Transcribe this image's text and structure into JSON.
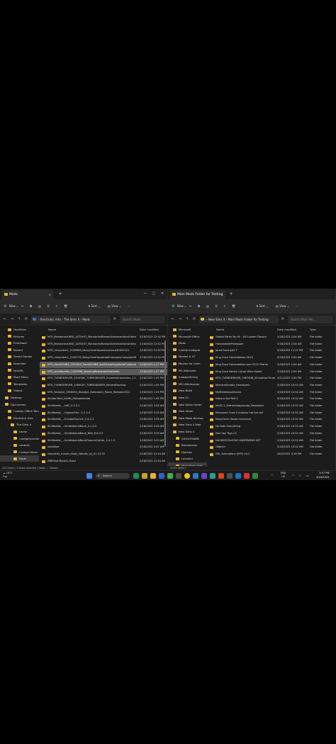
{
  "left": {
    "tab_title": "Mods",
    "toolbar": {
      "new": "New",
      "sort": "Sort",
      "view": "View"
    },
    "breadcrumb": "›  Electronic Arts  ›  The Sims 4  ›  Mods",
    "search_placeholder": "Search Mods",
    "columns": {
      "name": "Name",
      "date": "Date modified"
    },
    "nav": [
      {
        "label": "OneDrive"
      },
      {
        "label": "Pictures"
      },
      {
        "label": "PrintHood"
      },
      {
        "label": "Recent"
      },
      {
        "label": "Saved Games"
      },
      {
        "label": "Searches"
      },
      {
        "label": "SendTo"
      },
      {
        "label": "Start Menu"
      },
      {
        "label": "Templates"
      },
      {
        "label": "Videos"
      },
      {
        "label": "Desktop"
      },
      {
        "label": "Documents"
      },
      {
        "label": "Custom Office Tem"
      },
      {
        "label": "Electronic Arts"
      },
      {
        "label": "The Sims 4"
      },
      {
        "label": "cache"
      },
      {
        "label": "ConfigOverride"
      },
      {
        "label": "content"
      },
      {
        "label": "Custom Music"
      },
      {
        "label": "Mods"
      }
    ],
    "rows": [
      {
        "name": "MTS_Mandarinx0630_1875457_MandarinxRomanticInteractionsIntimateRelationships",
        "date": "2/18/2023 12:52 PM"
      },
      {
        "name": "MTS_Mandarinx0630_1875457_MandarinxRomanticInteractionsIntimateRelationships",
        "date": "2/18/2023 12:52 PM"
      },
      {
        "name": "MTS_nickyclem1_2198906_NickyClemHouseInsurance30092021",
        "date": "2/18/2023 12:52 PM"
      },
      {
        "name": "MTS_nickyclem1_2198776_NickyClemHouseholdCompanyComputerMenu",
        "date": "2/18/2023 12:52 PM"
      },
      {
        "name": "MTS_Sachi01884_2321815_Sachi01884_SachiLoveAnywhereCustomizationModHunt",
        "date": "2/18/2023 1:27 PM"
      },
      {
        "name": "MTS_scumbumbo_1553998_WorkingResidentialCabinets",
        "date": "2/18/2023 1:27 PM"
      },
      {
        "name": "MTS_TURBODRIVER_2529065_TURBODRIVER_Snowfreshlocksims_1.2",
        "date": "2/18/2023 1:05 PM"
      },
      {
        "name": "MTS_TURBODRIVER_2364097_TURBODRIVER_WhimsBlocking",
        "date": "2/18/2023 1:05 PM"
      },
      {
        "name": "MTS_Wuddyd_1966594_Wuddyd_Halloween_Movie_Remake2022",
        "date": "2/18/2023 1:05 PM"
      },
      {
        "name": "SimdanTalia_ACNH_Halloweensial",
        "date": "2/18/2023 1:05 PM"
      },
      {
        "name": "SimRealist_...UKC_0.2.3.1",
        "date": "2/18/2023 3:29 AM"
      },
      {
        "name": "SimRealist_...OrganicHer...2.1.3.4",
        "date": "2/18/2023 3:29 AM"
      },
      {
        "name": "SimRealist_...PrivatePractice_2.4.3.1",
        "date": "2/18/2023 3:29 AM"
      },
      {
        "name": "SimRealist_...SimNationalBank_3.1.0.5",
        "date": "2/18/2023 3:29 AM"
      },
      {
        "name": "SimRealist_...SimNationalBank_Bills_6.6.0.3",
        "date": "2/18/2023 3:29 AM"
      },
      {
        "name": "SimRealist_...SimNationalBankFinanceCenter_2.4.1.3",
        "date": "2/18/2023 3:29 AM"
      },
      {
        "name": "smobline",
        "date": "2/18/2023 3:47 AM"
      },
      {
        "name": "simplicity_tumalo_Body_Details_(z)_01.10.22",
        "date": "2/18/2023 12:44 AM"
      },
      {
        "name": "ZBEtristi.Blush5_Fixed",
        "date": "2/18/2023 12:53 AM"
      }
    ],
    "status": "414 items   |   2 items selected   |   State: ✓ Shared"
  },
  "right": {
    "tab_title": "Main Mods Folder for Testing",
    "toolbar": {
      "new": "New",
      "sort": "Sort",
      "view": "View"
    },
    "breadcrumb": "›  New Sims 4  ›  Main Mods Folder for Testing",
    "search_placeholder": "Search Main Mo...",
    "columns": {
      "name": "Name",
      "date": "Date modified",
      "type": "Type"
    },
    "nav": [
      {
        "label": "Microsoft"
      },
      {
        "label": "Microsoft Office"
      },
      {
        "label": "Mods"
      },
      {
        "label": "mothermodspm"
      },
      {
        "label": "Movies & XT"
      },
      {
        "label": "Movies for Calm"
      },
      {
        "label": "MS Alternate"
      },
      {
        "label": "msbaseid.tmp"
      },
      {
        "label": "MSI Afterburner"
      },
      {
        "label": "New Build"
      },
      {
        "label": "New CC"
      },
      {
        "label": "New Disco Folder"
      },
      {
        "label": "New folder"
      },
      {
        "label": "New Mods Backup"
      },
      {
        "label": "New Sims 4 Mod"
      },
      {
        "label": "New Sims 4"
      },
      {
        "label": "ZHOOTHAME"
      },
      {
        "label": "Bravescolor"
      },
      {
        "label": "Diamdo"
      },
      {
        "label": "Lancolor"
      },
      {
        "label": "Main Mods Fold"
      }
    ],
    "rows": [
      {
        "name": "Gelato Parlor By LB - 16 Custom Flavors",
        "date": "5/18/2023 2:04 AM",
        "type": "File folder"
      },
      {
        "name": "HarvestablePineapple",
        "date": "5/18/2023 2:04 AM",
        "type": "File folder"
      },
      {
        "name": "Jared Food part 7",
        "date": "5/18/2023 11:27 PM",
        "type": "File folder"
      },
      {
        "name": "King Zace Harvestables 2023",
        "date": "5/18/2023 2:04 AM",
        "type": "File folder"
      },
      {
        "name": "King Zace Harvestables and SCCO Plants",
        "date": "5/18/2023 2:04 AM",
        "type": "File folder"
      },
      {
        "name": "King Zace Nectar Liquor Wine Maker",
        "date": "5/18/2023 2:04 AM",
        "type": "File folder"
      },
      {
        "name": "MTS_TURBODRIVER_1967638_SimulationTimeIm...",
        "date": "4/11/2023 2:45 PM",
        "type": "File folder"
      },
      {
        "name": "MythicalAnodie_Headsome",
        "date": "5/18/2023 10:52 AM",
        "type": "File folder"
      },
      {
        "name": "MyMetalshopStories",
        "date": "5/18/2023 10:52 AM",
        "type": "File folder"
      },
      {
        "name": "Nahara Set Part 2",
        "date": "5/18/2023 10:52 AM",
        "type": "File folder"
      },
      {
        "name": "NCAT_2_ExtremeApprovals_Reworked",
        "date": "5/18/2023 10:52 AM",
        "type": "File folder"
      },
      {
        "name": "Nicksome Crew 4 outdoor hot tub set",
        "date": "5/18/2023 10:52 AM",
        "type": "File folder"
      },
      {
        "name": "NickyClem House Insurance",
        "date": "5/18/2023 10:52 AM",
        "type": "File folder"
      },
      {
        "name": "No Fade Everything",
        "date": "5/18/2023 10:52 AM",
        "type": "File folder"
      },
      {
        "name": "Noir Sex Toys CC",
        "date": "5/18/2023 10:52 AM",
        "type": "File folder"
      },
      {
        "name": "NUCKEES BLOOM UNDERWEAR SET",
        "date": "5/18/2023 10:52 AM",
        "type": "File folder"
      },
      {
        "name": "Objects",
        "date": "5/18/2023 10:52 AM",
        "type": "File folder"
      },
      {
        "name": "OSL Animations (AFS) V4.0",
        "date": "26/2/2023 3:18 PM",
        "type": "File folder"
      }
    ],
    "status": "4,022 items   |"
  },
  "taskbar": {
    "weather_temp": "14°C",
    "weather_desc": "Fog",
    "search_label": "Search",
    "lang": "ENG",
    "region": "US",
    "time": "3:57 PM",
    "date": "3/20/2023"
  }
}
